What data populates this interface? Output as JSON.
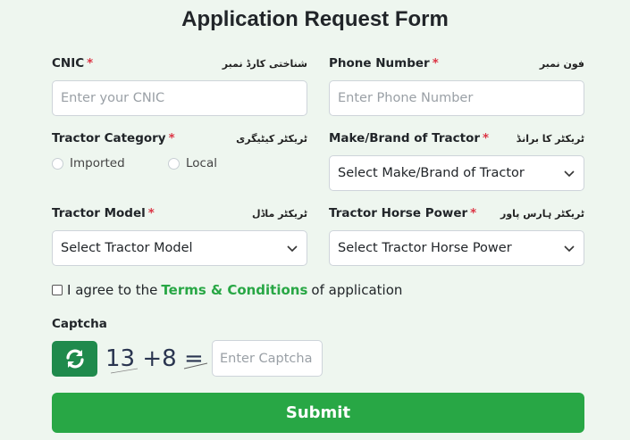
{
  "form": {
    "title": "Application Request Form",
    "cnic": {
      "label": "CNIC",
      "urdu": "شناختی کارڈ نمبر",
      "placeholder": "Enter your CNIC"
    },
    "phone": {
      "label": "Phone Number",
      "urdu": "فون نمبر",
      "placeholder": "Enter Phone Number"
    },
    "category": {
      "label": "Tractor Category",
      "urdu": "ٹریکٹر کیٹیگری",
      "options": [
        "Imported",
        "Local"
      ]
    },
    "brand": {
      "label": "Make/Brand of Tractor",
      "urdu": "ٹریکٹر کا برانڈ",
      "selected": "Select Make/Brand of Tractor"
    },
    "model": {
      "label": "Tractor Model",
      "urdu": "ٹریکٹر ماڈل",
      "selected": "Select Tractor Model"
    },
    "horse_power": {
      "label": "Tractor Horse Power",
      "urdu": "ٹریکٹر ہارس پاور",
      "selected": "Select Tractor Horse Power"
    },
    "required_mark": "*",
    "terms": {
      "prefix": "I agree to the",
      "link": "Terms & Conditions",
      "suffix": "of application"
    },
    "captcha": {
      "label": "Captcha",
      "text": "13 +8 =",
      "placeholder": "Enter Captcha"
    },
    "submit_label": "Submit"
  },
  "colors": {
    "accent": "#28a745",
    "refresh": "#1f8a4c",
    "required": "#dc3545",
    "background": "#eef6ef"
  },
  "icons": {
    "refresh": "refresh-icon",
    "dropdown": "chevron-down-icon"
  }
}
